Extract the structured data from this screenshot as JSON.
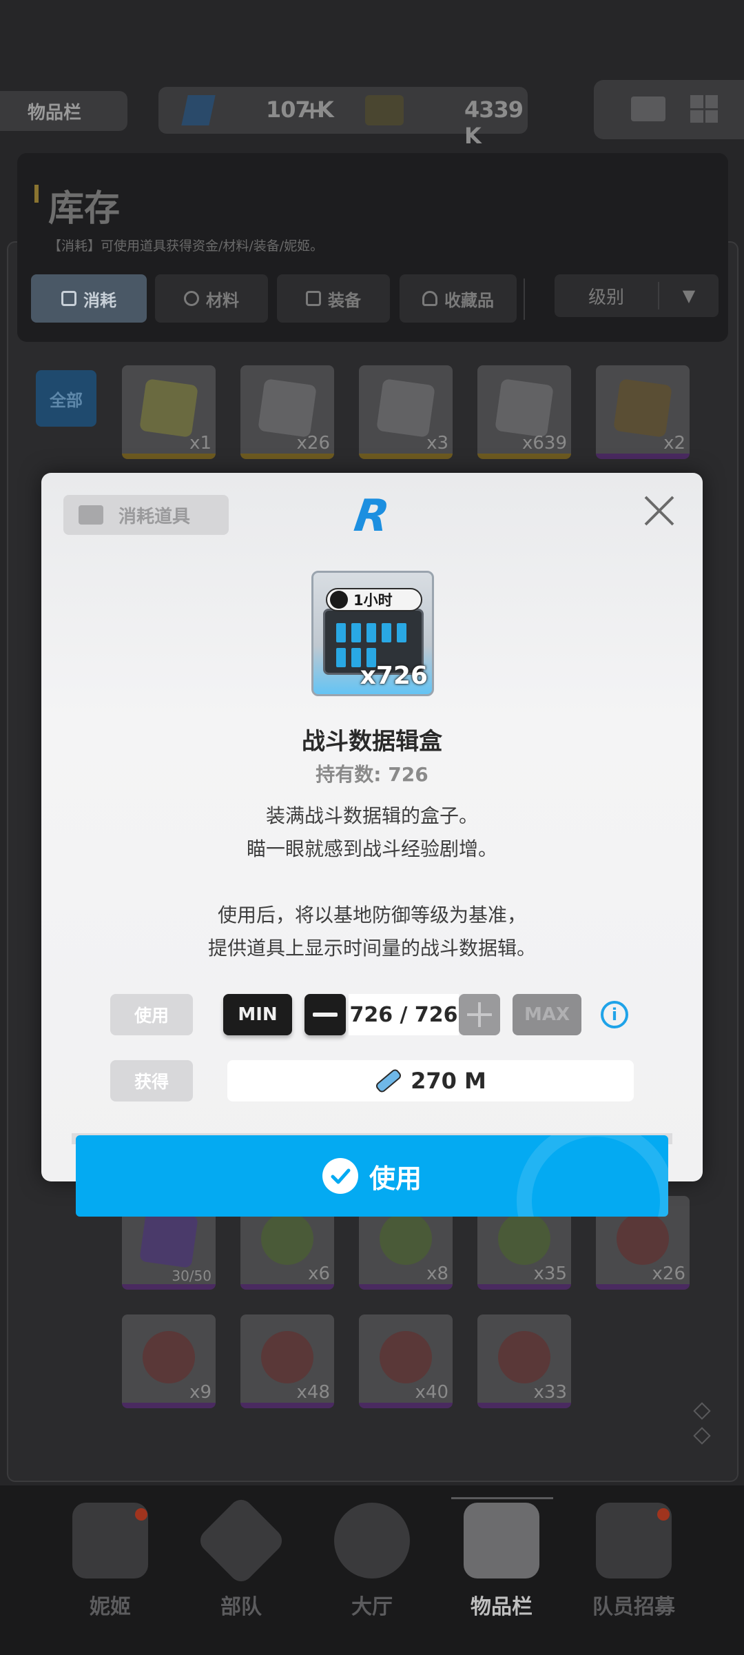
{
  "header": {
    "title": "物品栏",
    "currency_1": "107 K",
    "currency_1_add": "+",
    "currency_2": "4339 K"
  },
  "inventory": {
    "title": "库存",
    "description": "【消耗】可使用道具获得资金/材料/装备/妮姬。",
    "tabs": [
      "消耗",
      "材料",
      "装备",
      "收藏品"
    ],
    "sort_label": "级别",
    "filter_all": "全部",
    "row1_counts": [
      "x1",
      "x26",
      "x3",
      "x639",
      "x2"
    ],
    "row2_counts": [
      "30/50",
      "x6",
      "x8",
      "x35",
      "x26"
    ],
    "row3_counts": [
      "x9",
      "x48",
      "x40",
      "x33"
    ]
  },
  "modal": {
    "category": "消耗道具",
    "rarity": "R",
    "item_badge": "1小时",
    "item_qty": "x726",
    "item_name": "战斗数据辑盒",
    "owned": "持有数: 726",
    "desc_lines": [
      "装满战斗数据辑的盒子。",
      "瞄一眼就感到战斗经验剧增。",
      "使用后，将以基地防御等级为基准，",
      "提供道具上显示时间量的战斗数据辑。"
    ],
    "use_label": "使用",
    "gain_label": "获得",
    "min_label": "MIN",
    "max_label": "MAX",
    "quantity": "726 / 726",
    "reward": "270 M",
    "confirm_label": "使用"
  },
  "nav": {
    "items": [
      "妮姬",
      "部队",
      "大厅",
      "物品栏",
      "队员招募"
    ],
    "active": "物品栏"
  },
  "colors": {
    "accent": "#04aaf2",
    "rarity": "#1c8fe0"
  }
}
